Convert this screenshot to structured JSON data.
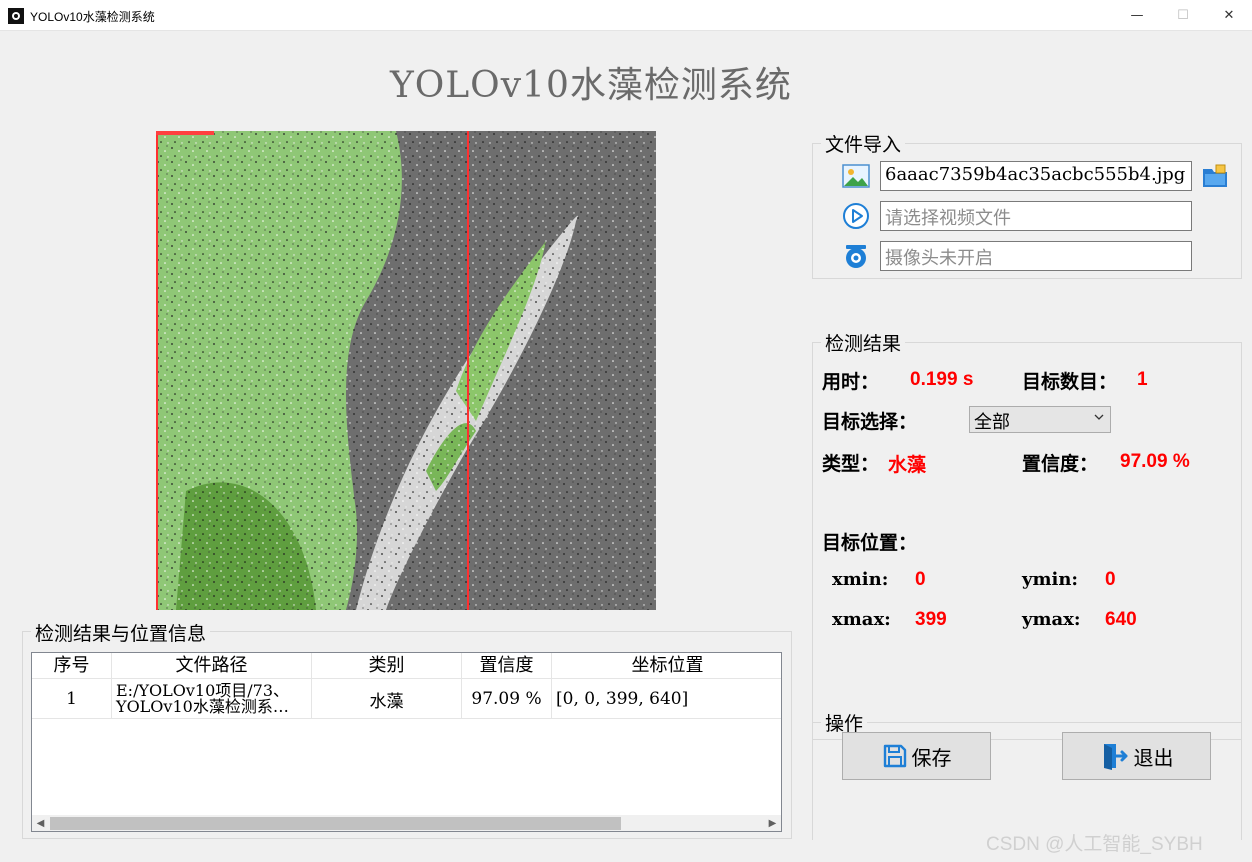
{
  "window": {
    "title": "YOLOv10水藻检测系统"
  },
  "app_title": "YOLOv10水藻检测系统",
  "file_import": {
    "group_title": "文件导入",
    "image_value": "6aaac7359b4ac35acbc555b4.jpg",
    "video_placeholder": "请选择视频文件",
    "camera_placeholder": "摄像头未开启"
  },
  "detection": {
    "group_title": "检测结果",
    "time_label": "用时：",
    "time_value": "0.199 s",
    "count_label": "目标数目：",
    "count_value": "1",
    "select_label": "目标选择：",
    "select_value": "全部",
    "type_label": "类型：",
    "type_value": "水藻",
    "conf_label": "置信度：",
    "conf_value": "97.09 %",
    "position_label": "目标位置：",
    "xmin_label": "xmin:",
    "xmin_value": "0",
    "ymin_label": "ymin:",
    "ymin_value": "0",
    "xmax_label": "xmax:",
    "xmax_value": "399",
    "ymax_label": "ymax:",
    "ymax_value": "640"
  },
  "operations": {
    "group_title": "操作",
    "save_label": "保存",
    "exit_label": "退出"
  },
  "results_table": {
    "group_title": "检测结果与位置信息",
    "headers": [
      "序号",
      "文件路径",
      "类别",
      "置信度",
      "坐标位置"
    ],
    "rows": [
      {
        "index": "1",
        "path_line1": "E:/YOLOv10项目/73、",
        "path_line2": "YOLOv10水藻检测系…",
        "category": "水藻",
        "confidence": "97.09 %",
        "coords": "[0, 0, 399, 640]"
      }
    ]
  },
  "watermark": "CSDN @人工智能_SYBH",
  "colors": {
    "accent_blue": "#1e7fd6",
    "value_red": "#ff0000",
    "box_red": "#ff4040"
  }
}
